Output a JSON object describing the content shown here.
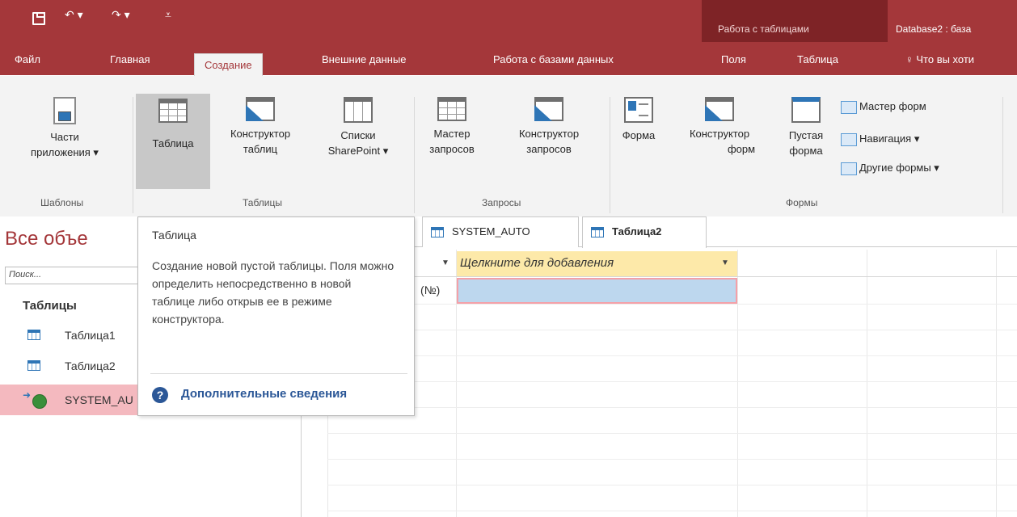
{
  "title_bar": {
    "context_group": "Работа с таблицами",
    "document_title": "Database2 : база"
  },
  "ribbon_tabs": [
    {
      "label": "Файл"
    },
    {
      "label": "Главная"
    },
    {
      "label": "Создание",
      "active": true
    },
    {
      "label": "Внешние данные"
    },
    {
      "label": "Работа с базами данных"
    },
    {
      "label": "Поля"
    },
    {
      "label": "Таблица"
    },
    {
      "label": "Что вы хоти"
    }
  ],
  "ribbon": {
    "templates": {
      "group": "Шаблоны",
      "app_parts_l1": "Части",
      "app_parts_l2": "приложения ▾"
    },
    "tables": {
      "group": "Таблицы",
      "table": "Таблица",
      "designer_l1": "Конструктор",
      "designer_l2": "таблиц",
      "sp_l1": "Списки",
      "sp_l2": "SharePoint ▾"
    },
    "queries": {
      "group": "Запросы",
      "wizard_l1": "Мастер",
      "wizard_l2": "запросов",
      "designer_l1": "Конструктор",
      "designer_l2": "запросов"
    },
    "forms": {
      "group": "Формы",
      "form": "Форма",
      "designer_l1": "Конструктор",
      "designer_l2": "форм",
      "blank_l1": "Пустая",
      "blank_l2": "форма",
      "wizard": "Мастер форм",
      "navigation": "Навигация ▾",
      "more": "Другие формы ▾"
    }
  },
  "nav_pane": {
    "title": "Все объе",
    "search_placeholder": "Поиск...",
    "section": "Таблицы",
    "items": [
      {
        "label": "Таблица1"
      },
      {
        "label": "Таблица2"
      },
      {
        "label": "SYSTEM_AU"
      }
    ]
  },
  "tooltip": {
    "title": "Таблица",
    "body": "Создание новой пустой таблицы. Поля можно определить непосредственно в новой таблице либо открыв ее в режиме конструктора.",
    "help_link": "Дополнительные сведения"
  },
  "doc_tabs": [
    {
      "label": "SYSTEM_AUTO"
    },
    {
      "label": "Таблица2",
      "active": true
    }
  ],
  "datasheet": {
    "add_column_header": "Щелкните для добавления",
    "new_row_id": "(№)"
  },
  "colors": {
    "accent": "#a4373a",
    "context_tab": "#7e2326",
    "selected_nav": "#f4b9bf",
    "new_cell": "#bdd7ee",
    "header_highlight": "#fde9a9",
    "link": "#2b5797"
  }
}
